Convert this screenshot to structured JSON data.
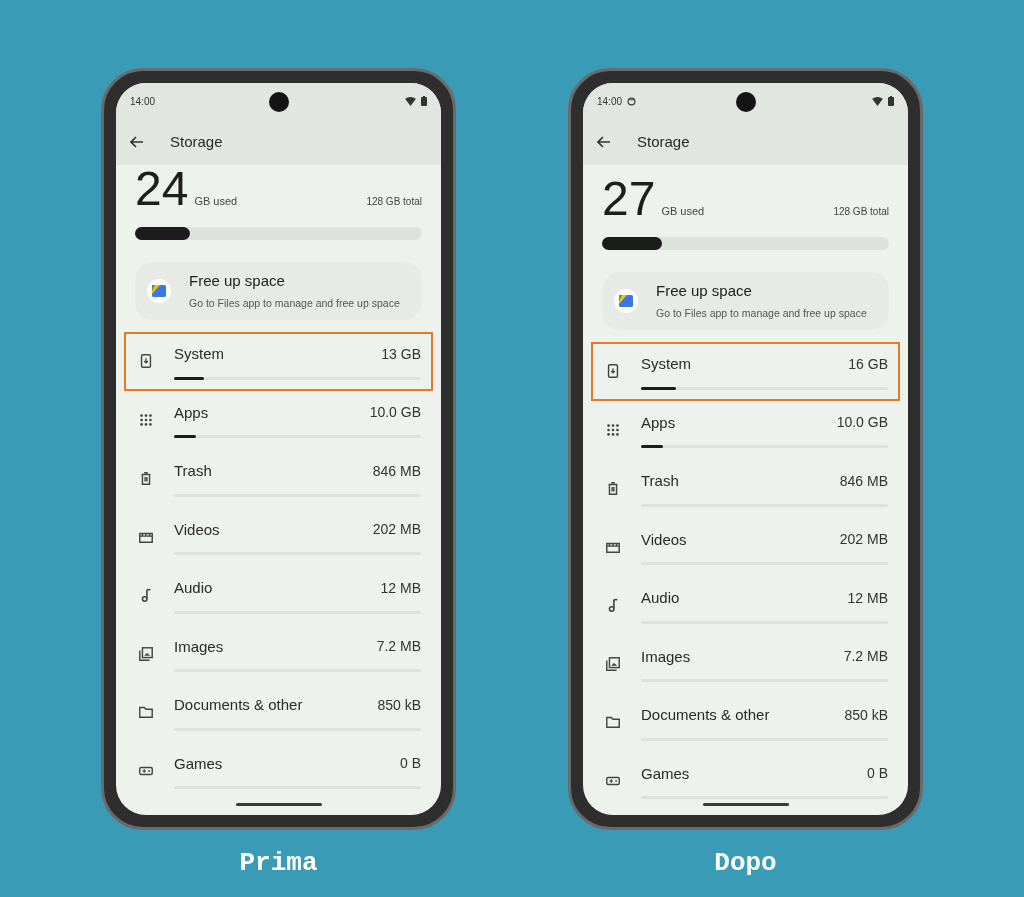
{
  "phones": [
    {
      "caption": "Prima",
      "status_bar": {
        "time": "14:00",
        "extra_icon": false
      },
      "app_bar": {
        "title": "Storage"
      },
      "scrolled": true,
      "summary": {
        "used_number": "24",
        "used_label": "GB used",
        "total": "128 GB total",
        "level": 0.19
      },
      "card": {
        "title": "Free up space",
        "subtitle": "Go to Files app to manage and free up space"
      },
      "categories": [
        {
          "kind": "system",
          "label": "System",
          "value": "13 GB",
          "level": 0.12,
          "highlighted": true
        },
        {
          "kind": "apps",
          "label": "Apps",
          "value": "10.0 GB",
          "level": 0.09,
          "highlighted": false
        },
        {
          "kind": "trash",
          "label": "Trash",
          "value": "846 MB",
          "level": 0,
          "highlighted": false
        },
        {
          "kind": "videos",
          "label": "Videos",
          "value": "202 MB",
          "level": 0,
          "highlighted": false
        },
        {
          "kind": "audio",
          "label": "Audio",
          "value": "12 MB",
          "level": 0,
          "highlighted": false
        },
        {
          "kind": "images",
          "label": "Images",
          "value": "7.2 MB",
          "level": 0,
          "highlighted": false
        },
        {
          "kind": "documents",
          "label": "Documents & other",
          "value": "850 kB",
          "level": 0,
          "highlighted": false
        },
        {
          "kind": "games",
          "label": "Games",
          "value": "0 B",
          "level": 0,
          "highlighted": false
        }
      ]
    },
    {
      "caption": "Dopo",
      "status_bar": {
        "time": "14:00",
        "extra_icon": true
      },
      "app_bar": {
        "title": "Storage"
      },
      "scrolled": false,
      "summary": {
        "used_number": "27",
        "used_label": "GB used",
        "total": "128 GB total",
        "level": 0.21
      },
      "card": {
        "title": "Free up space",
        "subtitle": "Go to Files app to manage and free up space"
      },
      "categories": [
        {
          "kind": "system",
          "label": "System",
          "value": "16 GB",
          "level": 0.14,
          "highlighted": true
        },
        {
          "kind": "apps",
          "label": "Apps",
          "value": "10.0 GB",
          "level": 0.09,
          "highlighted": false
        },
        {
          "kind": "trash",
          "label": "Trash",
          "value": "846 MB",
          "level": 0,
          "highlighted": false
        },
        {
          "kind": "videos",
          "label": "Videos",
          "value": "202 MB",
          "level": 0,
          "highlighted": false
        },
        {
          "kind": "audio",
          "label": "Audio",
          "value": "12 MB",
          "level": 0,
          "highlighted": false
        },
        {
          "kind": "images",
          "label": "Images",
          "value": "7.2 MB",
          "level": 0,
          "highlighted": false
        },
        {
          "kind": "documents",
          "label": "Documents & other",
          "value": "850 kB",
          "level": 0,
          "highlighted": false
        },
        {
          "kind": "games",
          "label": "Games",
          "value": "0 B",
          "level": 0,
          "highlighted": false
        }
      ]
    }
  ]
}
